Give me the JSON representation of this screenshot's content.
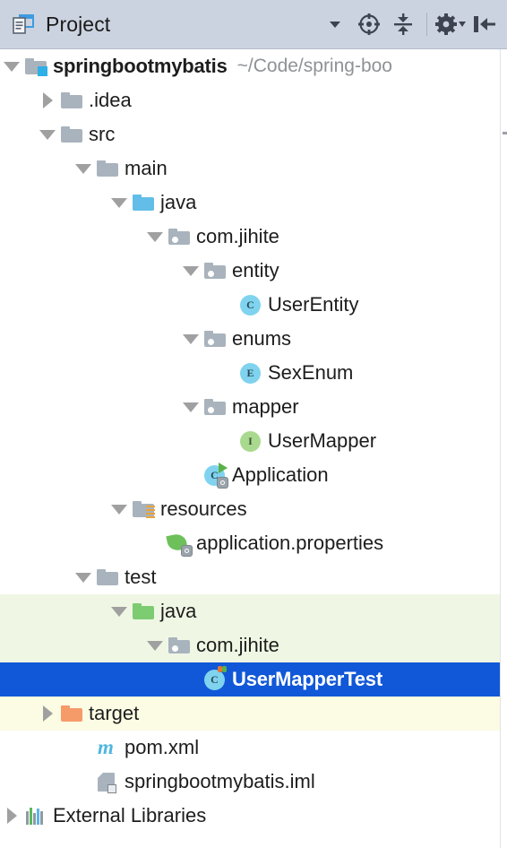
{
  "toolbar": {
    "title": "Project",
    "project_icon": "project-view-icon",
    "buttons": [
      {
        "name": "view-options-dropdown",
        "icon": "chevron-down-icon"
      },
      {
        "name": "scroll-from-source-button",
        "icon": "crosshair-target-icon"
      },
      {
        "name": "collapse-all-button",
        "icon": "collapse-all-icon"
      },
      {
        "name": "settings-button",
        "icon": "gear-icon"
      },
      {
        "name": "hide-panel-button",
        "icon": "hide-left-icon"
      }
    ]
  },
  "colors": {
    "toolbar_bg": "#ccd3e0",
    "selection_bg": "#1158d8",
    "selection_fg": "#ffffff",
    "test_scope_bg": "#eff7e4",
    "excluded_bg": "#fcfbe3",
    "folder_gray": "#a9b3bd",
    "folder_blue": "#62bde8",
    "folder_green": "#7dcc72",
    "folder_orange": "#f59b6a",
    "class_icon": "#7fd3ef",
    "interface_icon": "#a9d98e",
    "path_text": "#8f9295",
    "text": "#1d1d1d"
  },
  "tree": {
    "nodes": [
      {
        "label": "springbootmybatis",
        "secondary": "~/Code/spring-boo",
        "icon": "module-folder-icon",
        "twisty": "expanded",
        "depth": 0,
        "bold": true,
        "state": "normal",
        "name": "tree-node-springbootmybatis"
      },
      {
        "label": ".idea",
        "secondary": "",
        "icon": "folder-icon",
        "twisty": "collapsed",
        "depth": 1,
        "bold": false,
        "state": "normal",
        "name": "tree-node-idea"
      },
      {
        "label": "src",
        "secondary": "",
        "icon": "folder-icon",
        "twisty": "expanded",
        "depth": 1,
        "bold": false,
        "state": "normal",
        "name": "tree-node-src"
      },
      {
        "label": "main",
        "secondary": "",
        "icon": "folder-icon",
        "twisty": "expanded",
        "depth": 2,
        "bold": false,
        "state": "normal",
        "name": "tree-node-main"
      },
      {
        "label": "java",
        "secondary": "",
        "icon": "source-root-folder-icon",
        "twisty": "expanded",
        "depth": 3,
        "bold": false,
        "state": "normal",
        "name": "tree-node-main-java"
      },
      {
        "label": "com.jihite",
        "secondary": "",
        "icon": "package-folder-icon",
        "twisty": "expanded",
        "depth": 4,
        "bold": false,
        "state": "normal",
        "name": "tree-node-main-com-jihite"
      },
      {
        "label": "entity",
        "secondary": "",
        "icon": "package-folder-icon",
        "twisty": "expanded",
        "depth": 5,
        "bold": false,
        "state": "normal",
        "name": "tree-node-entity"
      },
      {
        "label": "UserEntity",
        "secondary": "",
        "icon": "java-class-icon",
        "twisty": "none",
        "depth": 6,
        "bold": false,
        "state": "normal",
        "name": "tree-node-userentity"
      },
      {
        "label": "enums",
        "secondary": "",
        "icon": "package-folder-icon",
        "twisty": "expanded",
        "depth": 5,
        "bold": false,
        "state": "normal",
        "name": "tree-node-enums"
      },
      {
        "label": "SexEnum",
        "secondary": "",
        "icon": "java-enum-icon",
        "twisty": "none",
        "depth": 6,
        "bold": false,
        "state": "normal",
        "name": "tree-node-sexenum"
      },
      {
        "label": "mapper",
        "secondary": "",
        "icon": "package-folder-icon",
        "twisty": "expanded",
        "depth": 5,
        "bold": false,
        "state": "normal",
        "name": "tree-node-mapper"
      },
      {
        "label": "UserMapper",
        "secondary": "",
        "icon": "java-interface-icon",
        "twisty": "none",
        "depth": 6,
        "bold": false,
        "state": "normal",
        "name": "tree-node-usermapper"
      },
      {
        "label": "Application",
        "secondary": "",
        "icon": "spring-boot-runnable-class-icon",
        "twisty": "none",
        "depth": 5,
        "bold": false,
        "state": "normal",
        "name": "tree-node-application"
      },
      {
        "label": "resources",
        "secondary": "",
        "icon": "resources-root-folder-icon",
        "twisty": "expanded",
        "depth": 3,
        "bold": false,
        "state": "normal",
        "name": "tree-node-resources"
      },
      {
        "label": "application.properties",
        "secondary": "",
        "icon": "spring-properties-icon",
        "twisty": "none",
        "depth": 4,
        "bold": false,
        "state": "normal",
        "name": "tree-node-application-properties"
      },
      {
        "label": "test",
        "secondary": "",
        "icon": "folder-icon",
        "twisty": "expanded",
        "depth": 2,
        "bold": false,
        "state": "normal",
        "name": "tree-node-test"
      },
      {
        "label": "java",
        "secondary": "",
        "icon": "test-source-root-folder-icon",
        "twisty": "expanded",
        "depth": 3,
        "bold": false,
        "state": "test-scope",
        "name": "tree-node-test-java"
      },
      {
        "label": "com.jihite",
        "secondary": "",
        "icon": "package-folder-icon",
        "twisty": "expanded",
        "depth": 4,
        "bold": false,
        "state": "test-scope",
        "name": "tree-node-test-com-jihite"
      },
      {
        "label": "UserMapperTest",
        "secondary": "",
        "icon": "java-test-class-icon",
        "twisty": "none",
        "depth": 5,
        "bold": true,
        "state": "selected",
        "name": "tree-node-usermappertest"
      },
      {
        "label": "target",
        "secondary": "",
        "icon": "excluded-folder-icon",
        "twisty": "collapsed",
        "depth": 1,
        "bold": false,
        "state": "excluded",
        "name": "tree-node-target"
      },
      {
        "label": "pom.xml",
        "secondary": "",
        "icon": "maven-pom-icon",
        "twisty": "none",
        "depth": 2,
        "bold": false,
        "state": "normal",
        "name": "tree-node-pom-xml"
      },
      {
        "label": "springbootmybatis.iml",
        "secondary": "",
        "icon": "iml-module-file-icon",
        "twisty": "none",
        "depth": 2,
        "bold": false,
        "state": "normal",
        "name": "tree-node-springbootmybatis-iml"
      },
      {
        "label": "External Libraries",
        "secondary": "",
        "icon": "external-libraries-icon",
        "twisty": "collapsed",
        "depth": 0,
        "bold": false,
        "state": "normal",
        "name": "tree-node-external-libraries"
      }
    ]
  }
}
